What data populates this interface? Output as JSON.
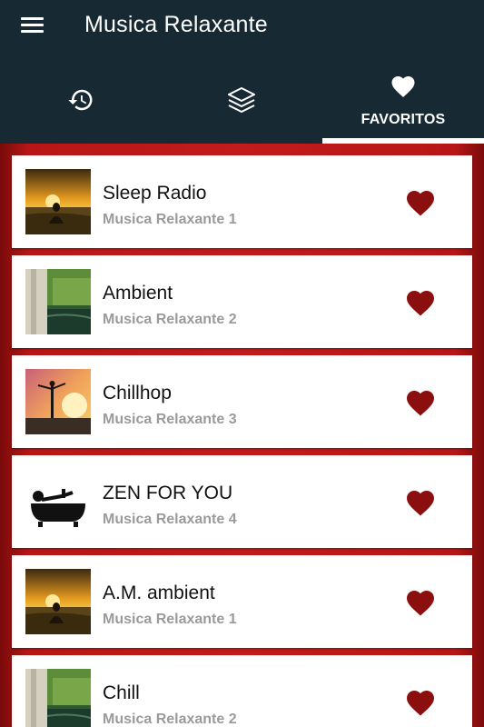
{
  "app": {
    "title": "Musica Relaxante"
  },
  "icons": {
    "menu": "menu-icon",
    "history": "history-icon",
    "layers": "layers-icon",
    "favorites": "heart-icon"
  },
  "tabs": [
    {
      "id": "history",
      "icon": "history-icon",
      "label": ""
    },
    {
      "id": "layers",
      "icon": "layers-icon",
      "label": ""
    },
    {
      "id": "favorites",
      "icon": "heart-icon",
      "label": "FAVORITOS",
      "active": true
    }
  ],
  "colors": {
    "appbar": "#172a33",
    "background": "#c21b1b",
    "heart": "#8b0f0f",
    "subtitle": "#9a9a9a"
  },
  "stations": [
    {
      "name": "Sleep Radio",
      "subtitle": "Musica Relaxante 1",
      "thumb": "sunset-meditation"
    },
    {
      "name": "Ambient",
      "subtitle": "Musica Relaxante 2",
      "thumb": "forest-waterfall"
    },
    {
      "name": "Chillhop",
      "subtitle": "Musica Relaxante 3",
      "thumb": "sunrise-stretch"
    },
    {
      "name": "ZEN FOR YOU",
      "subtitle": "Musica Relaxante 4",
      "thumb": "bathtub"
    },
    {
      "name": "A.M. ambient",
      "subtitle": "Musica Relaxante 1",
      "thumb": "sunset-meditation"
    },
    {
      "name": "Chill",
      "subtitle": "Musica Relaxante 2",
      "thumb": "forest-waterfall"
    }
  ]
}
